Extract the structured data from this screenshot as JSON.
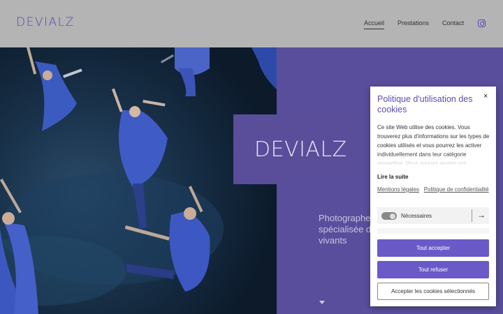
{
  "header": {
    "logo": "DEVIALZ",
    "nav": [
      {
        "label": "Accueil",
        "active": true
      },
      {
        "label": "Prestations",
        "active": false
      },
      {
        "label": "Contact",
        "active": false
      }
    ],
    "social_icon": "instagram-icon"
  },
  "hero": {
    "title": "DEVIALZ",
    "subtitle": "Photographe spécialisée da vivants",
    "scroll_icon": "caret-down-icon"
  },
  "cookie_modal": {
    "title": "Politique d'utilisation des cookies",
    "close_label": "×",
    "body": "Ce site Web utilise des cookies. Vous trouverez plus d'informations sur les types de cookies utilisés et vous pourrez les activer individuellement dans leur catégorie respective. Vous pouvez ajuster vos",
    "read_more": "Lire la suite",
    "link_mentions": "Mentions légales",
    "link_privacy": "Politique de confidentialité",
    "toggle_label": "Nécessaires",
    "toggle_on": true,
    "arrow_label": "→",
    "accept_all": "Tout accepter",
    "refuse_all": "Tout refuser",
    "accept_selected": "Accepter les cookies sélectionnés"
  },
  "colors": {
    "brand": "#5546b0",
    "hero_bg": "#594e9b",
    "button": "#6a5ac8"
  }
}
